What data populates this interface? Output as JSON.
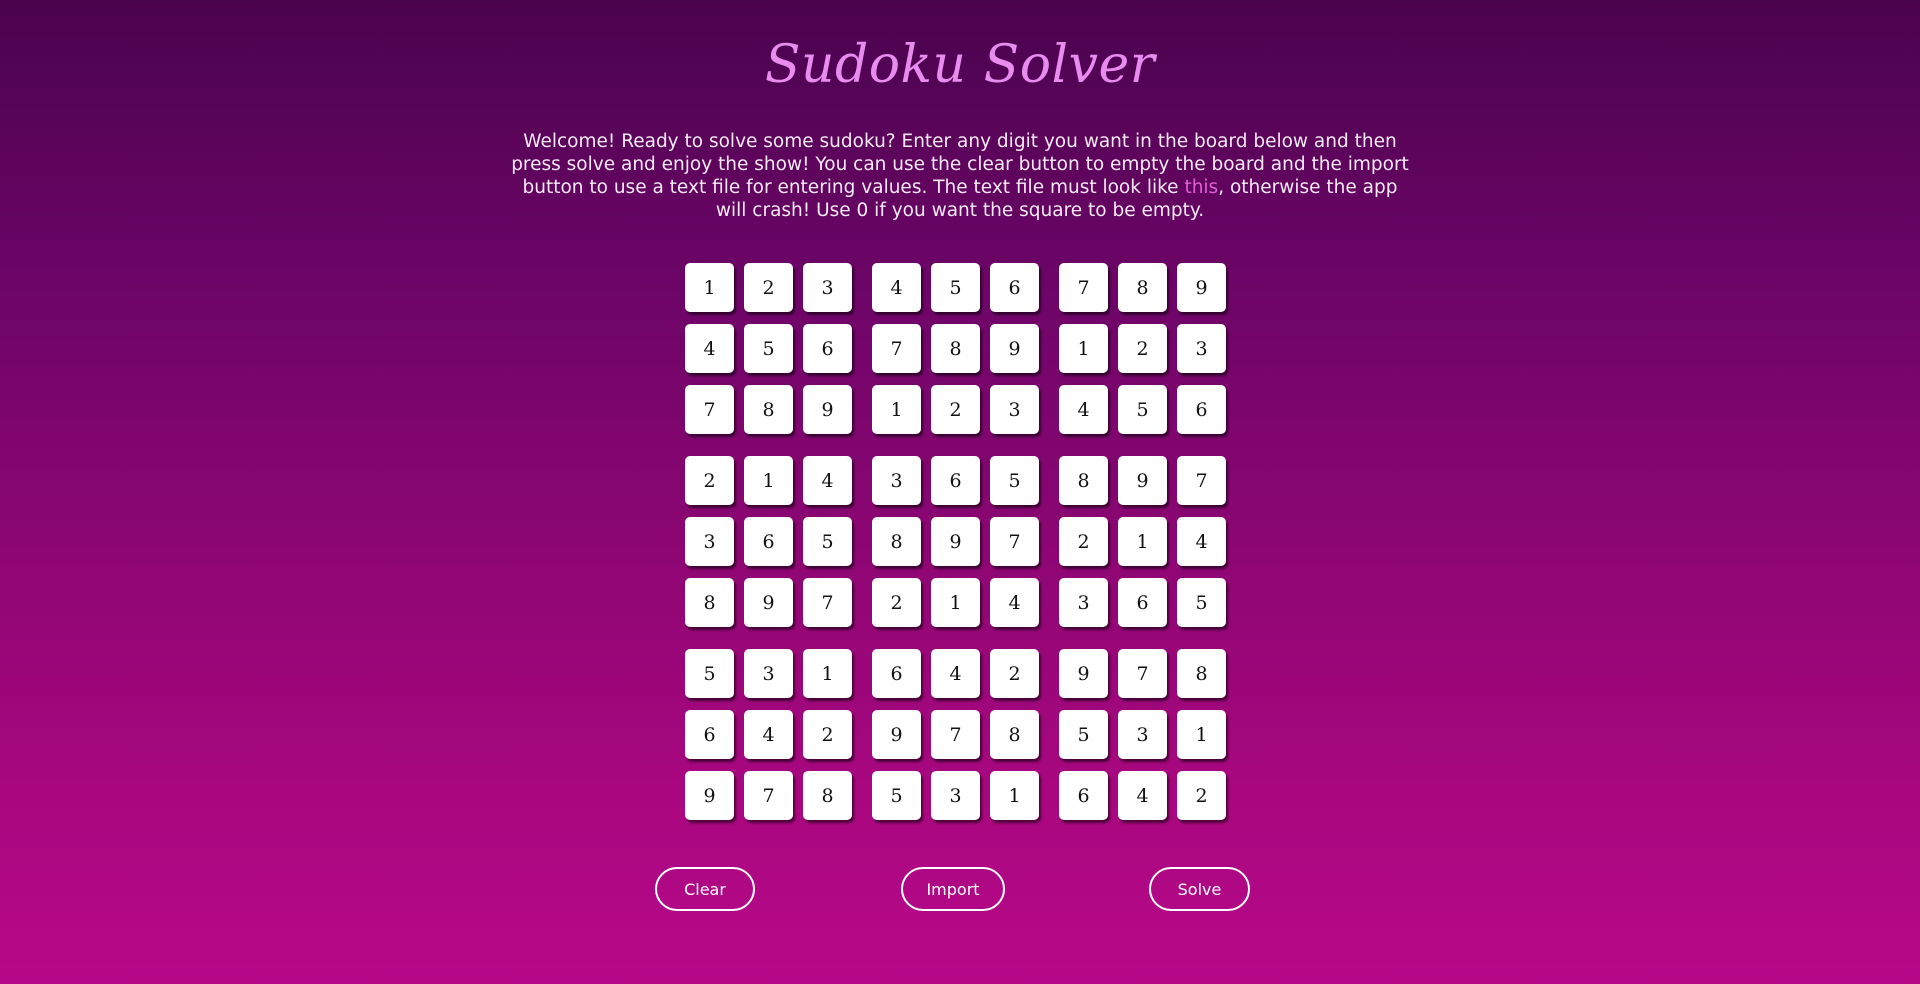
{
  "title": "Sudoku Solver",
  "intro": {
    "before_link": "Welcome! Ready to solve some sudoku? Enter any digit you want in the board below and then press solve and enjoy the show! You can use the clear button to empty the board and the import button to use a text file for entering values. The text file must look like ",
    "link_text": "this",
    "after_link": ", otherwise the app will crash! Use 0 if you want the square to be empty."
  },
  "board": [
    [
      "1",
      "2",
      "3",
      "4",
      "5",
      "6",
      "7",
      "8",
      "9"
    ],
    [
      "4",
      "5",
      "6",
      "7",
      "8",
      "9",
      "1",
      "2",
      "3"
    ],
    [
      "7",
      "8",
      "9",
      "1",
      "2",
      "3",
      "4",
      "5",
      "6"
    ],
    [
      "2",
      "1",
      "4",
      "3",
      "6",
      "5",
      "8",
      "9",
      "7"
    ],
    [
      "3",
      "6",
      "5",
      "8",
      "9",
      "7",
      "2",
      "1",
      "4"
    ],
    [
      "8",
      "9",
      "7",
      "2",
      "1",
      "4",
      "3",
      "6",
      "5"
    ],
    [
      "5",
      "3",
      "1",
      "6",
      "4",
      "2",
      "9",
      "7",
      "8"
    ],
    [
      "6",
      "4",
      "2",
      "9",
      "7",
      "8",
      "5",
      "3",
      "1"
    ],
    [
      "9",
      "7",
      "8",
      "5",
      "3",
      "1",
      "6",
      "4",
      "2"
    ]
  ],
  "buttons": {
    "clear": "Clear",
    "import": "Import",
    "solve": "Solve"
  },
  "colors": {
    "title": "#e88cf0",
    "link": "#e05fd6",
    "background_top": "#4a034e",
    "background_bottom": "#b7088a"
  }
}
